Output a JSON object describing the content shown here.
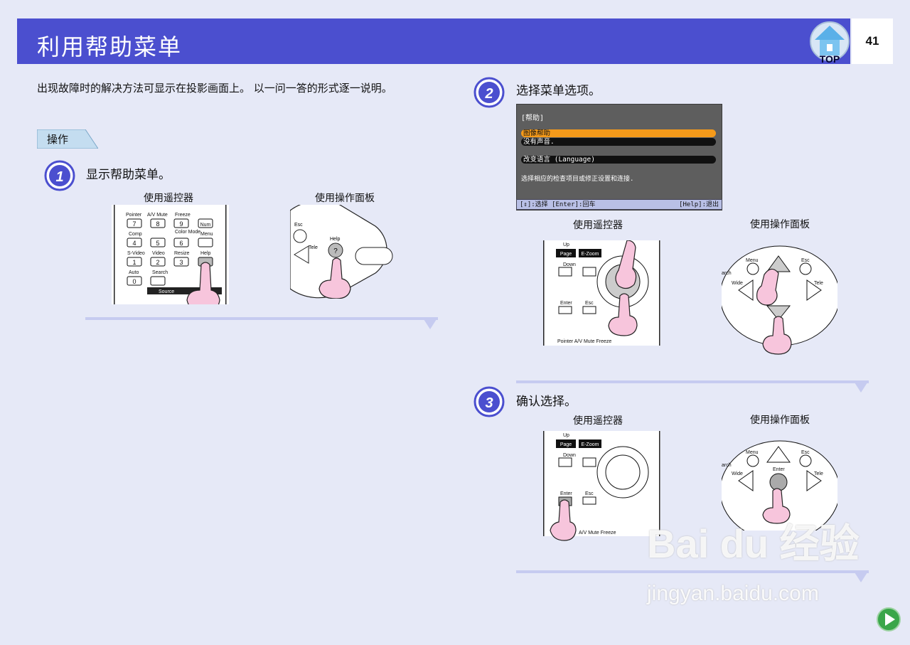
{
  "header": {
    "title": "利用帮助菜单",
    "page_number": "41",
    "top_label": "TOP"
  },
  "intro": "出现故障时的解决方法可显示在投影画面上。 以一问一答的形式逐一说明。",
  "operation_tab": "操作",
  "steps": [
    {
      "number": "1",
      "text": "显示帮助菜单。",
      "left_caption": "使用遥控器",
      "right_caption": "使用操作面板"
    },
    {
      "number": "2",
      "text": "选择菜单选项。",
      "left_caption": "使用遥控器",
      "right_caption": "使用操作面板"
    },
    {
      "number": "3",
      "text": "确认选择。",
      "left_caption": "使用遥控器",
      "right_caption": "使用操作面板"
    }
  ],
  "remote1": {
    "rows": [
      [
        "Pointer",
        "A/V Mute",
        "Freeze",
        ""
      ],
      [
        "Comp",
        "",
        "Color Mode",
        "Menu"
      ],
      [
        "S-Video",
        "Video",
        "Resize",
        "Help"
      ],
      [
        "Auto",
        "Search",
        "",
        ""
      ]
    ],
    "keys": [
      "7",
      "8",
      "9",
      "Num",
      "4",
      "5",
      "6",
      "1",
      "2",
      "3",
      "0"
    ],
    "source_label": "Source"
  },
  "panel1": {
    "esc": "Esc",
    "help": "Help",
    "tele": "Tele"
  },
  "help_menu": {
    "title": "[帮助]",
    "items": [
      "图像帮助",
      "没有声音.",
      "改变语言 (Language)"
    ],
    "hint": "选择相应的检查项目或修正设置和连接.",
    "footer_left": "[⇕]:选择 [Enter]:回车",
    "footer_right": "[Help]:退出"
  },
  "remote2": {
    "up": "Up",
    "page": "Page",
    "ezoom": "E-Zoom",
    "down": "Down",
    "enter": "Enter",
    "esc": "Esc",
    "bottom": "Pointer  A/V Mute  Freeze"
  },
  "panel2": {
    "menu": "Menu",
    "esc": "Esc",
    "wide": "Wide",
    "tele": "Tele",
    "search": "arch"
  },
  "remote3": {
    "up": "Up",
    "page": "Page",
    "ezoom": "E-Zoom",
    "down": "Down",
    "enter": "Enter",
    "esc": "Esc",
    "bottom": "A/V Mute  Freeze"
  },
  "panel3": {
    "menu": "Menu",
    "esc": "Esc",
    "wide": "Wide",
    "tele": "Tele",
    "enter": "Enter",
    "search": "arch"
  },
  "watermark": {
    "main": "Bai du 经验",
    "sub": "jingyan.baidu.com"
  },
  "colors": {
    "header": "#4b4fcf",
    "background": "#e6e9f7",
    "accent_orange": "#f59a1a",
    "hand_pink": "#f7c5dc"
  }
}
